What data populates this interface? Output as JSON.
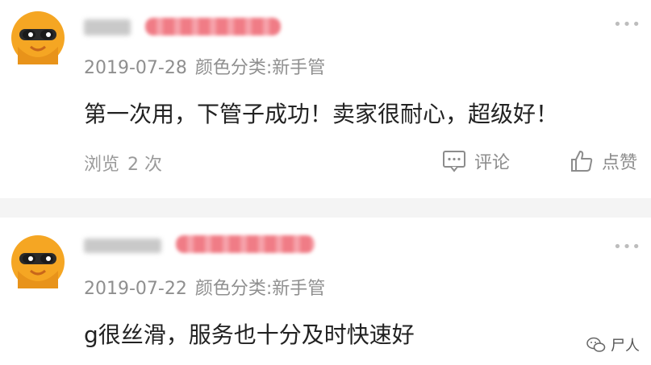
{
  "reviews": [
    {
      "date": "2019-07-28",
      "variant": "颜色分类:新手管",
      "content": "第一次用，下管子成功！卖家很耐心，超级好！",
      "views_label": "浏览",
      "views_count": "2 次",
      "comment_label": "评论",
      "like_label": "点赞"
    },
    {
      "date": "2019-07-22",
      "variant": "颜色分类:新手管",
      "content": "g很丝滑，服务也十分及时快速好"
    }
  ],
  "more_glyph": "•••",
  "watermark": {
    "text": "尸人"
  },
  "icons": [
    "avatar",
    "more-icon",
    "comment-icon",
    "like-icon",
    "wechat-icon"
  ],
  "colors": {
    "avatar_bg": "#f5a623",
    "mask": "#2a2a2a",
    "level_badge": "#f07c86"
  }
}
